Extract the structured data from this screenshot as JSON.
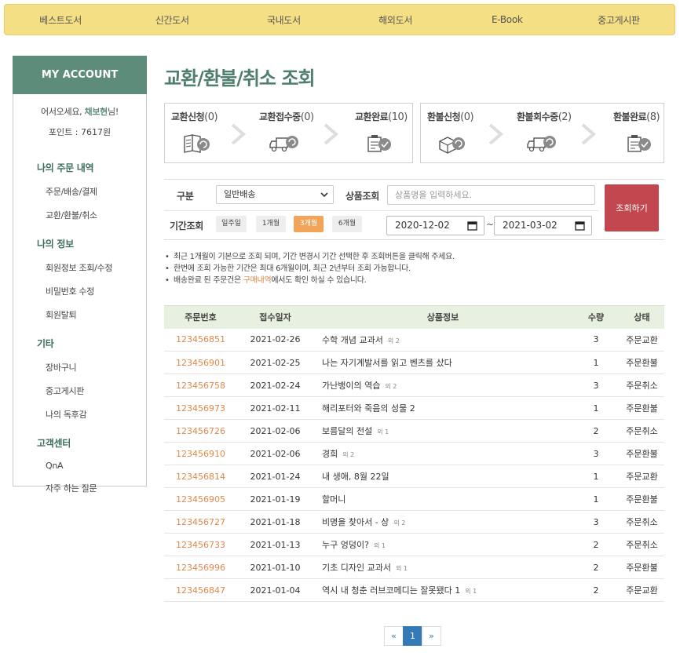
{
  "topnav": [
    "베스트도서",
    "신간도서",
    "국내도서",
    "해외도서",
    "E-Book",
    "중고게시판"
  ],
  "sidebar": {
    "title": "MY ACCOUNT",
    "greeting_prefix": "어서오세요,",
    "greeting_name": "채보현",
    "greeting_suffix": "님!",
    "points": "포인트 : 7617원",
    "sections": [
      {
        "title": "나의 주문 내역",
        "links": [
          "주문/배송/결제",
          "교환/환불/취소"
        ]
      },
      {
        "title": "나의 정보",
        "links": [
          "회원정보 조회/수정",
          "비밀번호 수정",
          "회원탈퇴"
        ]
      },
      {
        "title": "기타",
        "links": [
          "장바구니",
          "중고게시판",
          "나의 독후감"
        ]
      },
      {
        "title": "고객센터",
        "links": [
          "QnA",
          "자주 하는 질문"
        ]
      }
    ]
  },
  "page_title": "교환/환불/취소 조회",
  "exchange_steps": [
    {
      "label": "교환신청",
      "count": "(0)",
      "icon": "book-refresh-icon"
    },
    {
      "label": "교환접수중",
      "count": "(0)",
      "icon": "truck-refresh-icon"
    },
    {
      "label": "교환완료",
      "count": "(10)",
      "icon": "clipboard-check-icon"
    }
  ],
  "refund_steps": [
    {
      "label": "환불신청",
      "count": "(0)",
      "icon": "box-refresh-icon"
    },
    {
      "label": "환불회수중",
      "count": "(2)",
      "icon": "truck-refresh-icon"
    },
    {
      "label": "환불완료",
      "count": "(8)",
      "icon": "clipboard-check-icon"
    }
  ],
  "filter": {
    "type_label": "구분",
    "type_value": "일반배송",
    "product_label": "상품조회",
    "product_placeholder": "상품명을 입력하세요.",
    "period_label": "기간조회",
    "periods": [
      "일주일",
      "1개월",
      "3개월",
      "6개월"
    ],
    "active_period": "3개월",
    "date_from": "2020-12-02",
    "date_sep": "~",
    "date_to": "2021-03-02",
    "search_button": "조회하기"
  },
  "notes": [
    "최근 1개월이 기본으로 조회 되며, 기간 변경시 기간 선택한 후 조회버튼을 클릭해 주세요.",
    "한번에 조회 가능한 기간은 최대 6개월이며, 최근 2년부터 조회 가능합니다."
  ],
  "note3": {
    "prefix": "배송완료 된 주문건은 ",
    "link": "구매내역",
    "suffix": "에서도 확인 하실 수 있습니다."
  },
  "table": {
    "headers": [
      "주문번호",
      "접수일자",
      "상품정보",
      "수량",
      "상태"
    ],
    "rows": [
      {
        "no": "123456851",
        "date": "2021-02-26",
        "product": "수학 개념 교과서",
        "extra": "외 2",
        "qty": "3",
        "status": "주문교환"
      },
      {
        "no": "123456901",
        "date": "2021-02-25",
        "product": "나는 자기계발서를 읽고 벤츠를 샀다",
        "extra": "",
        "qty": "1",
        "status": "주문환불"
      },
      {
        "no": "123456758",
        "date": "2021-02-24",
        "product": "가난뱅이의 역습",
        "extra": "외 2",
        "qty": "3",
        "status": "주문취소"
      },
      {
        "no": "123456973",
        "date": "2021-02-11",
        "product": "해리포터와 죽음의 성물 2",
        "extra": "",
        "qty": "1",
        "status": "주문환불"
      },
      {
        "no": "123456726",
        "date": "2021-02-06",
        "product": "보름달의 전설",
        "extra": "외 1",
        "qty": "2",
        "status": "주문취소"
      },
      {
        "no": "123456910",
        "date": "2021-02-06",
        "product": "경희",
        "extra": "외 2",
        "qty": "3",
        "status": "주문환불"
      },
      {
        "no": "123456814",
        "date": "2021-01-24",
        "product": "내 생애, 8월 22일",
        "extra": "",
        "qty": "1",
        "status": "주문교환"
      },
      {
        "no": "123456905",
        "date": "2021-01-19",
        "product": "할머니",
        "extra": "",
        "qty": "1",
        "status": "주문환불"
      },
      {
        "no": "123456727",
        "date": "2021-01-18",
        "product": "비명을 찾아서 - 상",
        "extra": "외 2",
        "qty": "3",
        "status": "주문취소"
      },
      {
        "no": "123456733",
        "date": "2021-01-13",
        "product": "누구 엉덩이?",
        "extra": "외 1",
        "qty": "2",
        "status": "주문취소"
      },
      {
        "no": "123456996",
        "date": "2021-01-10",
        "product": "기초 디자인 교과서",
        "extra": "외 1",
        "qty": "2",
        "status": "주문환불"
      },
      {
        "no": "123456847",
        "date": "2021-01-04",
        "product": "역시 내 청춘 러브코메디는 잘못됐다 1",
        "extra": "외 1",
        "qty": "2",
        "status": "주문교환"
      }
    ]
  },
  "pagination": {
    "prev": "«",
    "current": "1",
    "next": "»"
  }
}
